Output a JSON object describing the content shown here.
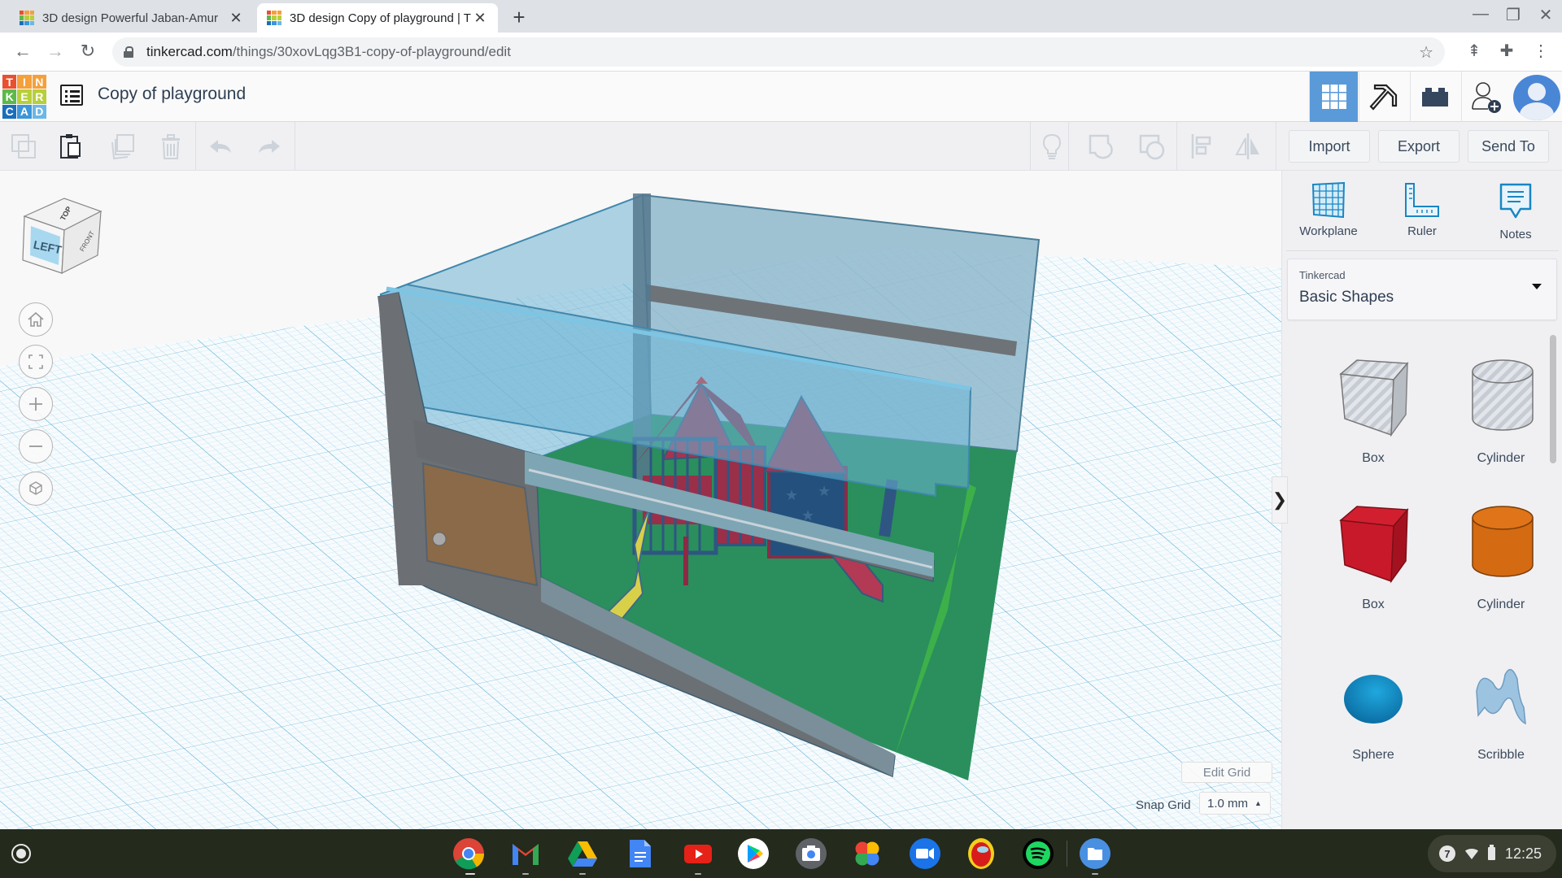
{
  "browser": {
    "tabs": [
      {
        "title": "3D design Powerful Jaban-Amur",
        "active": false
      },
      {
        "title": "3D design Copy of playground | T",
        "active": true
      }
    ],
    "new_tab_label": "+",
    "url_host": "tinkercad.com",
    "url_path": "/things/30xovLqg3B1-copy-of-playground/edit",
    "window_controls": {
      "minimize": "—",
      "restore": "❐",
      "close": "✕"
    }
  },
  "app": {
    "logo_letters": [
      "T",
      "I",
      "N",
      "K",
      "E",
      "R",
      "C",
      "A",
      "D"
    ],
    "logo_colors": [
      "#e8502f",
      "#f5a03a",
      "#f5a03a",
      "#5db94a",
      "#b7cf3b",
      "#b7cf3b",
      "#1a6ebc",
      "#3c96d9",
      "#6bb7e6"
    ],
    "design_title": "Copy of playground",
    "header_buttons": [
      {
        "name": "3d-design-view",
        "active": true
      },
      {
        "name": "codeblocks-view",
        "active": false
      },
      {
        "name": "bricks-view",
        "active": false
      },
      {
        "name": "invite-user",
        "active": false
      }
    ],
    "accent_color": "#5a9ad9"
  },
  "toolbar": {
    "left_tools": [
      "Copy",
      "Paste",
      "Duplicate",
      "Delete",
      "Undo",
      "Redo"
    ],
    "right_tools": [
      "Show/Hide",
      "Group",
      "Ungroup",
      "Align",
      "Mirror"
    ],
    "import_label": "Import",
    "export_label": "Export",
    "send_to_label": "Send To"
  },
  "viewport": {
    "viewcube": {
      "left": "LEFT",
      "top": "TOP",
      "front": "FRONT"
    },
    "nav_controls": [
      "Home view",
      "Fit all",
      "Zoom in",
      "Zoom out",
      "Orthographic"
    ],
    "edit_grid_label": "Edit Grid",
    "snap_grid_label": "Snap Grid",
    "snap_grid_value": "1.0 mm",
    "collapse_label": "❯"
  },
  "panel": {
    "tools": [
      {
        "label": "Workplane"
      },
      {
        "label": "Ruler"
      },
      {
        "label": "Notes"
      }
    ],
    "library_source": "Tinkercad",
    "library_name": "Basic Shapes",
    "shapes": [
      {
        "label": "Box",
        "kind": "hole-box"
      },
      {
        "label": "Cylinder",
        "kind": "hole-cylinder"
      },
      {
        "label": "Box",
        "kind": "box",
        "color": "#c8192a"
      },
      {
        "label": "Cylinder",
        "kind": "cylinder",
        "color": "#e07418"
      },
      {
        "label": "Sphere",
        "kind": "sphere",
        "color": "#1390c8"
      },
      {
        "label": "Scribble",
        "kind": "scribble",
        "color": "#9cc3e0"
      }
    ]
  },
  "shelf": {
    "apps": [
      "Chrome",
      "Gmail",
      "Drive",
      "Docs",
      "YouTube",
      "Play Store",
      "Camera",
      "Photos",
      "Zoom",
      "Among Us",
      "Spotify",
      "Files"
    ],
    "notification_count": "7",
    "time": "12:25"
  }
}
